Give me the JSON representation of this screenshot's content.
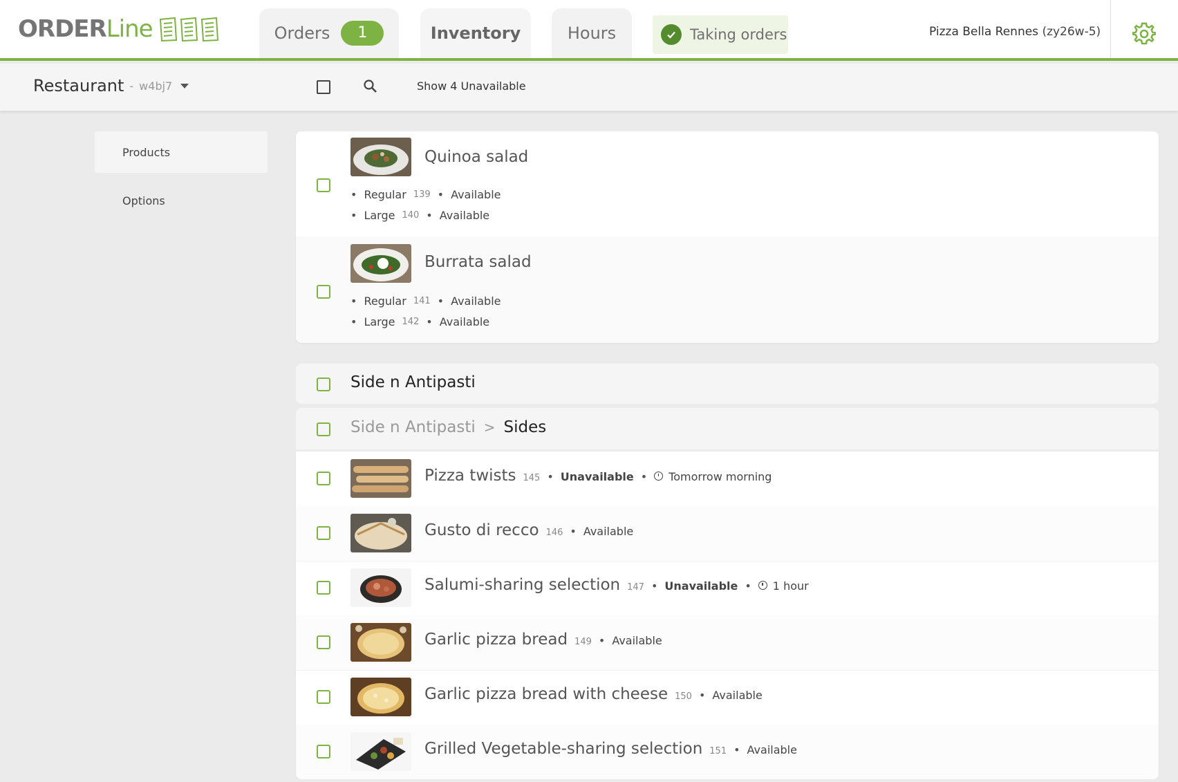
{
  "logo": {
    "order": "ORDER",
    "line": "Line"
  },
  "tabs": {
    "orders": "Orders",
    "orders_badge": "1",
    "inventory": "Inventory",
    "hours": "Hours",
    "taking_orders": "Taking orders"
  },
  "restaurant": {
    "name": "Pizza Bella Rennes",
    "id": "(zy26w-5)"
  },
  "subbar": {
    "restaurant_label": "Restaurant",
    "separator": "-",
    "restaurant_code": "w4bj7",
    "show_unavailable": "Show 4 Unavailable"
  },
  "sidenav": {
    "products": "Products",
    "options": "Options"
  },
  "salads": [
    {
      "name": "Quinoa salad",
      "variants": [
        {
          "size": "Regular",
          "num": "139",
          "status": "Available"
        },
        {
          "size": "Large",
          "num": "140",
          "status": "Available"
        }
      ]
    },
    {
      "name": "Burrata salad",
      "variants": [
        {
          "size": "Regular",
          "num": "141",
          "status": "Available"
        },
        {
          "size": "Large",
          "num": "142",
          "status": "Available"
        }
      ]
    }
  ],
  "category": {
    "title": "Side n Antipasti",
    "breadcrumb_parent": "Side n Antipasti",
    "breadcrumb_sep": ">",
    "breadcrumb_current": "Sides"
  },
  "sides": [
    {
      "name": "Pizza twists",
      "num": "145",
      "status": "Unavailable",
      "until": "Tomorrow morning"
    },
    {
      "name": "Gusto di recco",
      "num": "146",
      "status": "Available"
    },
    {
      "name": "Salumi-sharing selection",
      "num": "147",
      "status": "Unavailable",
      "until": "1 hour"
    },
    {
      "name": "Garlic pizza bread",
      "num": "149",
      "status": "Available"
    },
    {
      "name": "Garlic pizza bread with cheese",
      "num": "150",
      "status": "Available"
    },
    {
      "name": "Grilled Vegetable-sharing selection",
      "num": "151",
      "status": "Available"
    }
  ],
  "colors": {
    "accent": "#7cb342",
    "accent_dark": "#558b2f"
  },
  "icons": [
    "checkmark-icon",
    "search-icon",
    "gear-icon",
    "caret-down-icon",
    "clock-icon",
    "menu-card-icon"
  ]
}
